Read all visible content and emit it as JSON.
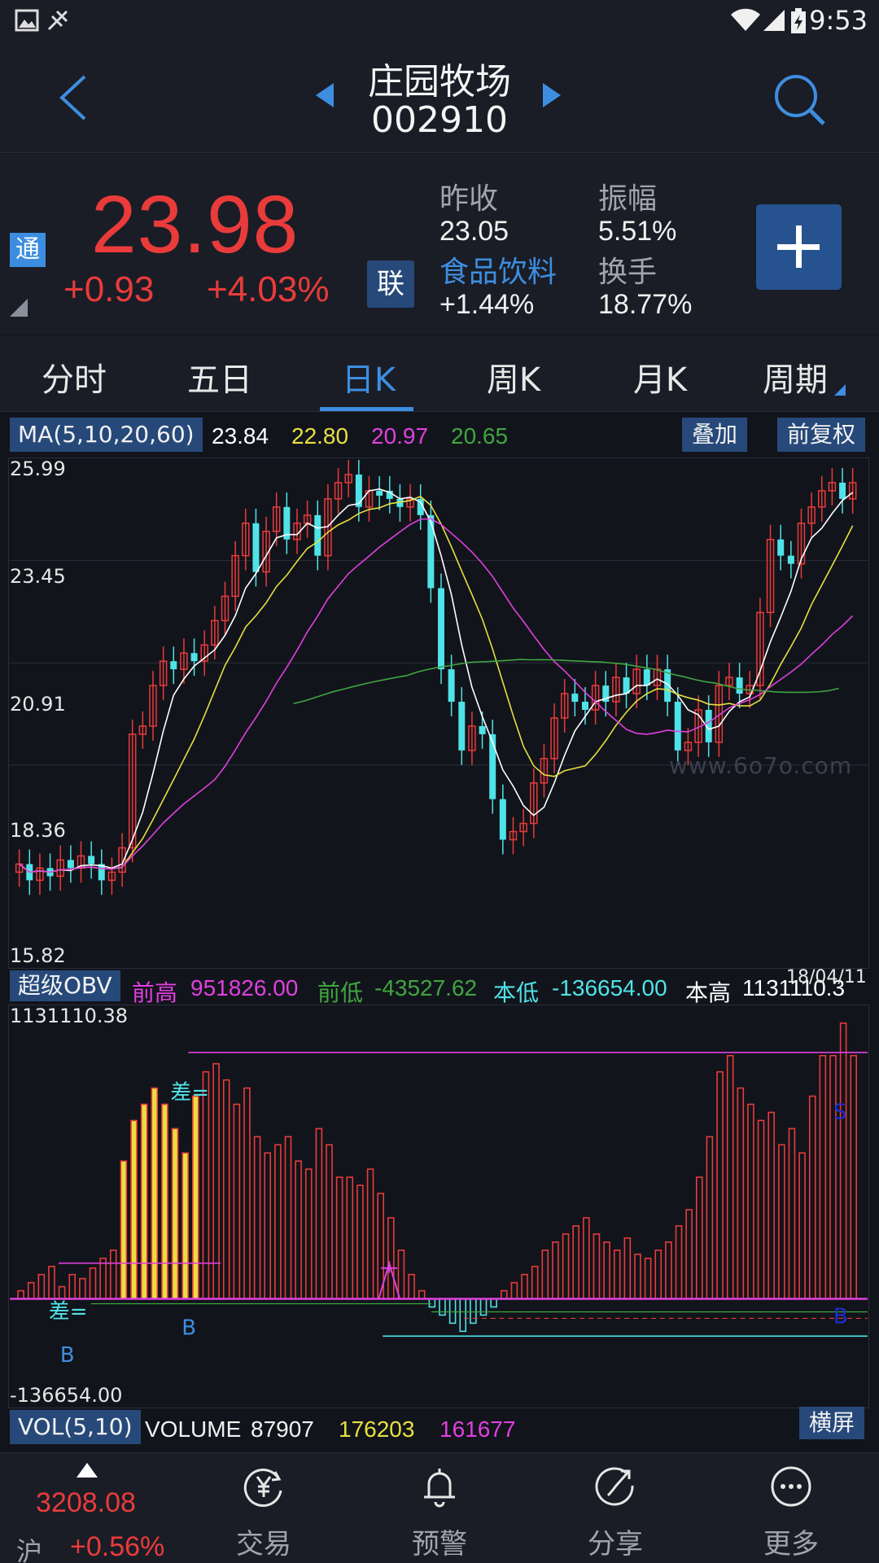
{
  "status": {
    "time": "9:53"
  },
  "header": {
    "stock_name": "庄园牧场",
    "stock_code": "002910"
  },
  "quote": {
    "badge_tong": "通",
    "price": "23.98",
    "change": "+0.93",
    "change_pct": "+4.03%",
    "badge_lian": "联",
    "prev_close_label": "昨收",
    "prev_close": "23.05",
    "sector_label": "食品饮料",
    "sector_pct": "+1.44%",
    "amplitude_label": "振幅",
    "amplitude": "5.51%",
    "turnover_label": "换手",
    "turnover": "18.77%"
  },
  "tabs": [
    {
      "label": "分时"
    },
    {
      "label": "五日"
    },
    {
      "label": "日K",
      "active": true
    },
    {
      "label": "周K"
    },
    {
      "label": "月K"
    },
    {
      "label": "周期"
    }
  ],
  "ma": {
    "label": "MA(5,10,20,60)",
    "ma5": "23.84",
    "ma10": "22.80",
    "ma20": "20.97",
    "ma60": "20.65",
    "overlay_btn": "叠加",
    "adjust_btn": "前复权"
  },
  "kchart": {
    "y_ticks": [
      "25.99",
      "23.45",
      "20.91",
      "18.36",
      "15.82"
    ],
    "watermark": "www.6o7o.com"
  },
  "obv": {
    "label": "超级OBV",
    "prev_high_label": "前高",
    "prev_high": "951826.00",
    "prev_low_label": "前低",
    "prev_low": "-43527.62",
    "cur_low_label": "本低",
    "cur_low": "-136654.00",
    "cur_high_label": "本高",
    "cur_high": "1131110.3",
    "date": "18/04/11",
    "max": "1131110.38",
    "min": "-136654.00",
    "marks": {
      "cha": "差=",
      "b": "B",
      "s": "S"
    }
  },
  "vol": {
    "label": "VOL(5,10)",
    "volume_label": "VOLUME",
    "volume": "87907",
    "v5": "176203",
    "v10": "161677",
    "landscape_btn": "横屏"
  },
  "bottom": {
    "index_price": "3208.08",
    "index_name": "沪",
    "index_pct": "+0.56%",
    "nav": [
      {
        "label": "交易",
        "icon": "yen-cycle-icon"
      },
      {
        "label": "预警",
        "icon": "bell-icon"
      },
      {
        "label": "分享",
        "icon": "share-icon"
      },
      {
        "label": "更多",
        "icon": "more-dots-icon"
      }
    ]
  },
  "colors": {
    "up": "#ea3b3b",
    "down": "#4fe3e8",
    "ma5": "#ffffff",
    "ma10": "#e6e040",
    "ma20": "#e040e0",
    "ma60": "#3fa63f",
    "accent": "#3d8ee0",
    "panel": "#1a1d26"
  }
}
